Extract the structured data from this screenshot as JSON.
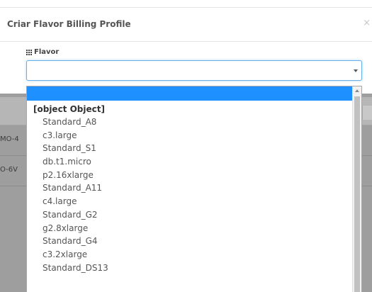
{
  "modal": {
    "title": "Criar Flavor Billing Profile",
    "close_label": "×",
    "field_label": "Flavor",
    "field_icon": "grid-icon",
    "select_value": ""
  },
  "background_rows": [
    {
      "text": "MO-4"
    },
    {
      "text": "O-6V"
    }
  ],
  "dropdown": {
    "group_label": "[object Object]",
    "options": [
      "Standard_A8",
      "c3.large",
      "Standard_S1",
      "db.t1.micro",
      "p2.16xlarge",
      "Standard_A11",
      "c4.large",
      "Standard_G2",
      "g2.8xlarge",
      "Standard_G4",
      "c3.2xlarge",
      "Standard_DS13"
    ]
  },
  "colors": {
    "accent": "#1e90ff",
    "focus_border": "#66afe9",
    "backdrop": "#9e9e9e"
  }
}
